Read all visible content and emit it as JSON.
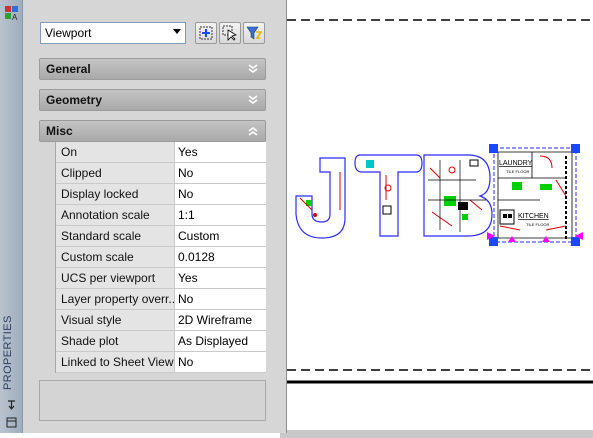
{
  "palette": {
    "title": "PROPERTIES",
    "object_selector": {
      "value": "Viewport"
    },
    "toolbar": [
      {
        "name": "toggle-pickadd",
        "icon": "pickadd-icon"
      },
      {
        "name": "select-objects",
        "icon": "select-objects-icon"
      },
      {
        "name": "quick-select",
        "icon": "quick-select-icon"
      }
    ],
    "sections": {
      "general": "General",
      "geometry": "Geometry",
      "misc": "Misc"
    },
    "misc_rows": [
      {
        "name": "On",
        "value": "Yes"
      },
      {
        "name": "Clipped",
        "value": "No"
      },
      {
        "name": "Display locked",
        "value": "No"
      },
      {
        "name": "Annotation scale",
        "value": "1:1"
      },
      {
        "name": "Standard scale",
        "value": "Custom"
      },
      {
        "name": "Custom scale",
        "value": "0.0128"
      },
      {
        "name": "UCS per viewport",
        "value": "Yes"
      },
      {
        "name": "Layer property overr...",
        "value": "No"
      },
      {
        "name": "Visual style",
        "value": "2D Wireframe"
      },
      {
        "name": "Shade plot",
        "value": "As Displayed"
      },
      {
        "name": "Linked to Sheet View",
        "value": "No"
      }
    ]
  },
  "drawing": {
    "room_labels": {
      "laundry": "LAUNDRY",
      "laundry_sub": "TILE FLOOR",
      "kitchen": "KITCHEN",
      "kitchen_sub": "TILE FLOOR"
    }
  },
  "colors": {
    "palette_strip": "#a9b6c5",
    "section_header": "#b5b5b5",
    "grip_blue": "#1a47ff",
    "wall_blue": "#2b2bff",
    "red_lines": "#e00000",
    "green_fill": "#00d000",
    "cyan": "#00c8c8",
    "magenta": "#ff00ff"
  }
}
